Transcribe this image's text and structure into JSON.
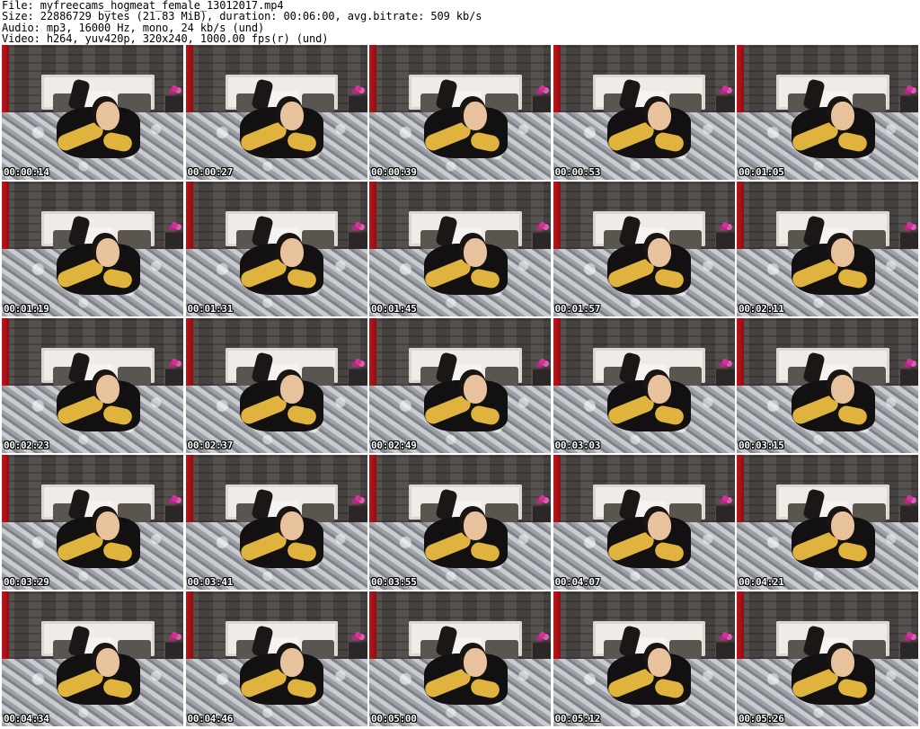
{
  "header": {
    "file_line": "File: myfreecams_hogmeat_female_13012017.mp4",
    "size_line": "Size: 22886729 bytes (21.83 MiB), duration: 00:06:00, avg.bitrate: 509 kb/s",
    "audio_line": "Audio: mp3, 16000 Hz, mono, 24 kb/s (und)",
    "video_line": "Video: h264, yuv420p, 320x240, 1000.00 fps(r) (und)"
  },
  "thumbnails": [
    {
      "timestamp": "00:00:14"
    },
    {
      "timestamp": "00:00:27"
    },
    {
      "timestamp": "00:00:39"
    },
    {
      "timestamp": "00:00:53"
    },
    {
      "timestamp": "00:01:05"
    },
    {
      "timestamp": "00:01:19"
    },
    {
      "timestamp": "00:01:31"
    },
    {
      "timestamp": "00:01:45"
    },
    {
      "timestamp": "00:01:57"
    },
    {
      "timestamp": "00:02:11"
    },
    {
      "timestamp": "00:02:23"
    },
    {
      "timestamp": "00:02:37"
    },
    {
      "timestamp": "00:02:49"
    },
    {
      "timestamp": "00:03:03"
    },
    {
      "timestamp": "00:03:15"
    },
    {
      "timestamp": "00:03:29"
    },
    {
      "timestamp": "00:03:41"
    },
    {
      "timestamp": "00:03:55"
    },
    {
      "timestamp": "00:04:07"
    },
    {
      "timestamp": "00:04:21"
    },
    {
      "timestamp": "00:04:34"
    },
    {
      "timestamp": "00:04:46"
    },
    {
      "timestamp": "00:05:00"
    },
    {
      "timestamp": "00:05:12"
    },
    {
      "timestamp": "00:05:26"
    }
  ]
}
